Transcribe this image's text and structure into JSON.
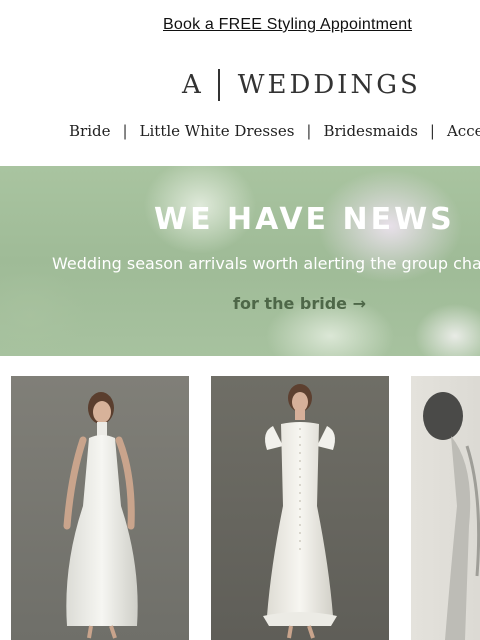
{
  "promo": {
    "text": "Book a FREE Styling Appointment"
  },
  "logo": {
    "mark": "A",
    "brand": "WEDDINGS"
  },
  "nav": {
    "items": [
      {
        "label": "Bride"
      },
      {
        "label": "Little White Dresses"
      },
      {
        "label": "Bridesmaids"
      },
      {
        "label": "Acces"
      }
    ],
    "separator": "|"
  },
  "hero": {
    "title": "WE HAVE NEWS",
    "subtitle": "Wedding season arrivals worth alerting the group cha",
    "cta": "for the bride →"
  },
  "products": [
    {
      "icon": "halter-dress-photo"
    },
    {
      "icon": "flutter-sleeve-dress-photo"
    },
    {
      "icon": "bw-dress-photo"
    }
  ],
  "colors": {
    "hero_green": "#a9c4a0",
    "cta_green": "#4e6748",
    "photo_bg": "#7d7c74"
  }
}
